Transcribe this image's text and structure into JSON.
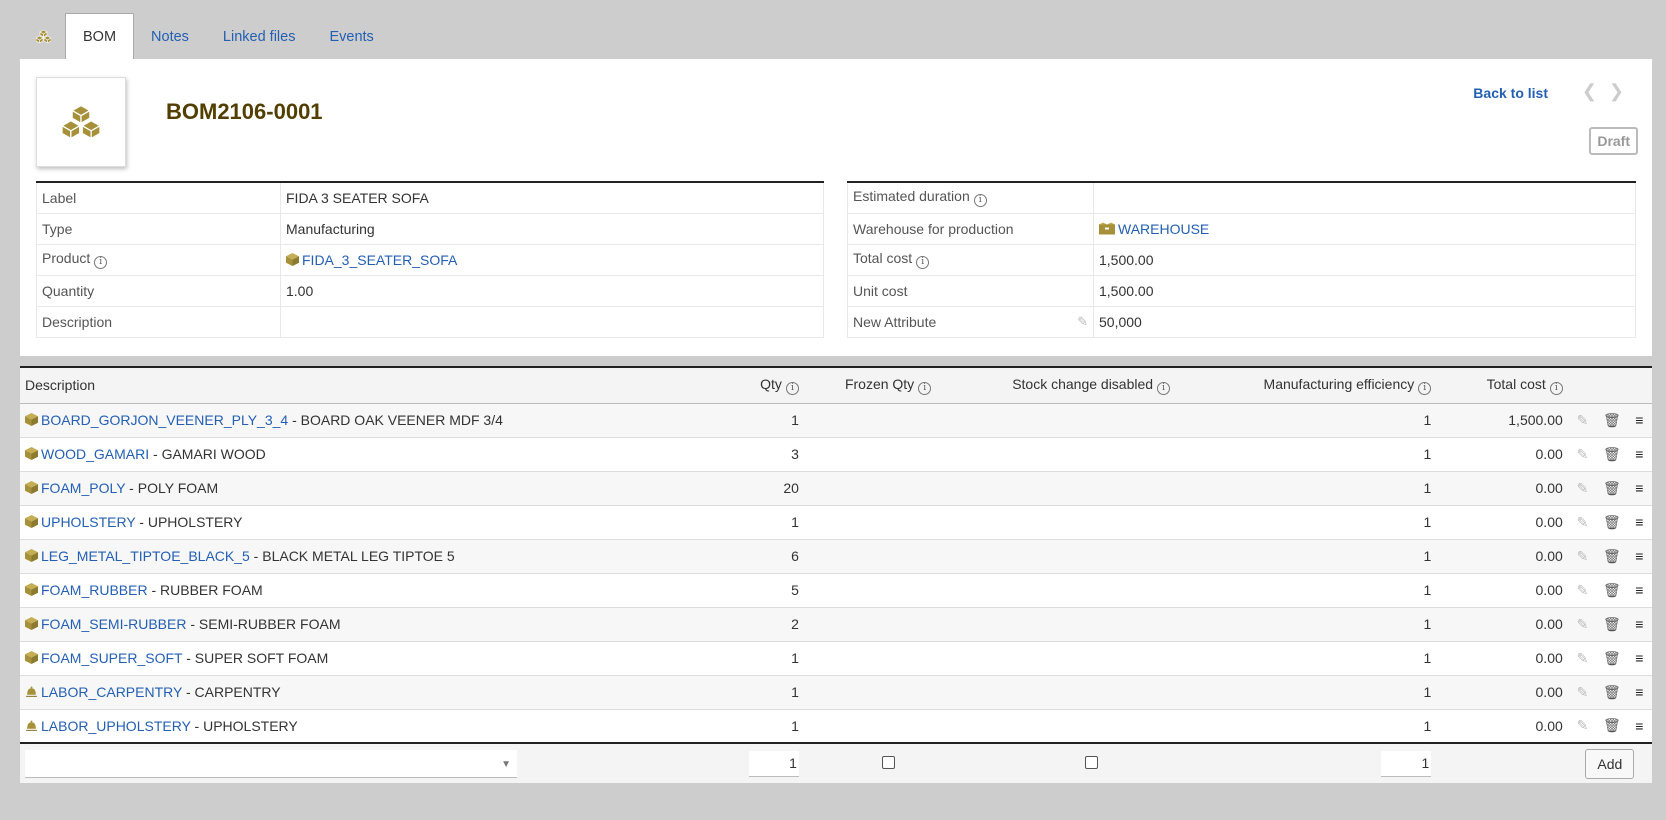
{
  "tabs": [
    {
      "label": "BOM",
      "active": true
    },
    {
      "label": "Notes"
    },
    {
      "label": "Linked files"
    },
    {
      "label": "Events"
    }
  ],
  "header": {
    "ref": "BOM2106-0001",
    "back_label": "Back to list",
    "status": "Draft",
    "prev_icon": "chevron-left-icon",
    "next_icon": "chevron-right-icon"
  },
  "fields_left": {
    "label": {
      "label": "Label",
      "value": "FIDA 3 SEATER SOFA"
    },
    "type": {
      "label": "Type",
      "value": "Manufacturing"
    },
    "product": {
      "label": "Product",
      "value": "FIDA_3_SEATER_SOFA"
    },
    "quantity": {
      "label": "Quantity",
      "value": "1.00"
    },
    "description": {
      "label": "Description",
      "value": ""
    }
  },
  "fields_right": {
    "duration": {
      "label": "Estimated duration",
      "value": ""
    },
    "warehouse": {
      "label": "Warehouse for production",
      "value": "WAREHOUSE"
    },
    "total_cost": {
      "label": "Total cost",
      "value": "1,500.00"
    },
    "unit_cost": {
      "label": "Unit cost",
      "value": "1,500.00"
    },
    "new_attr": {
      "label": "New Attribute",
      "value": "50,000"
    }
  },
  "lines": {
    "columns": {
      "description": "Description",
      "qty": "Qty",
      "frozen": "Frozen Qty",
      "stock": "Stock change disabled",
      "efficiency": "Manufacturing efficiency",
      "total": "Total cost"
    },
    "rows": [
      {
        "ref": "BOARD_GORJON_VEENER_PLY_3_4",
        "label": " - BOARD OAK VEENER MDF 3/4",
        "qty": "1",
        "eff": "1",
        "total": "1,500.00",
        "kind": "product"
      },
      {
        "ref": "WOOD_GAMARI",
        "label": " - GAMARI WOOD",
        "qty": "3",
        "eff": "1",
        "total": "0.00",
        "kind": "product"
      },
      {
        "ref": "FOAM_POLY",
        "label": " - POLY FOAM",
        "qty": "20",
        "eff": "1",
        "total": "0.00",
        "kind": "product"
      },
      {
        "ref": "UPHOLSTERY",
        "label": " - UPHOLSTERY",
        "qty": "1",
        "eff": "1",
        "total": "0.00",
        "kind": "product"
      },
      {
        "ref": "LEG_METAL_TIPTOE_BLACK_5",
        "label": " - BLACK METAL LEG TIPTOE 5",
        "qty": "6",
        "eff": "1",
        "total": "0.00",
        "kind": "product"
      },
      {
        "ref": "FOAM_RUBBER",
        "label": " - RUBBER FOAM",
        "qty": "5",
        "eff": "1",
        "total": "0.00",
        "kind": "product"
      },
      {
        "ref": "FOAM_SEMI-RUBBER",
        "label": " - SEMI-RUBBER FOAM",
        "qty": "2",
        "eff": "1",
        "total": "0.00",
        "kind": "product"
      },
      {
        "ref": "FOAM_SUPER_SOFT",
        "label": " - SUPER SOFT FOAM",
        "qty": "1",
        "eff": "1",
        "total": "0.00",
        "kind": "product"
      },
      {
        "ref": "LABOR_CARPENTRY",
        "label": " - CARPENTRY",
        "qty": "1",
        "eff": "1",
        "total": "0.00",
        "kind": "service"
      },
      {
        "ref": "LABOR_UPHOLSTERY",
        "label": " - UPHOLSTERY",
        "qty": "1",
        "eff": "1",
        "total": "0.00",
        "kind": "service"
      }
    ],
    "add_row": {
      "qty": "1",
      "eff": "1",
      "add_label": "Add"
    }
  },
  "colors": {
    "link": "#235fb3",
    "ref_title": "#523e00",
    "icon_gold": "#a6913a"
  }
}
